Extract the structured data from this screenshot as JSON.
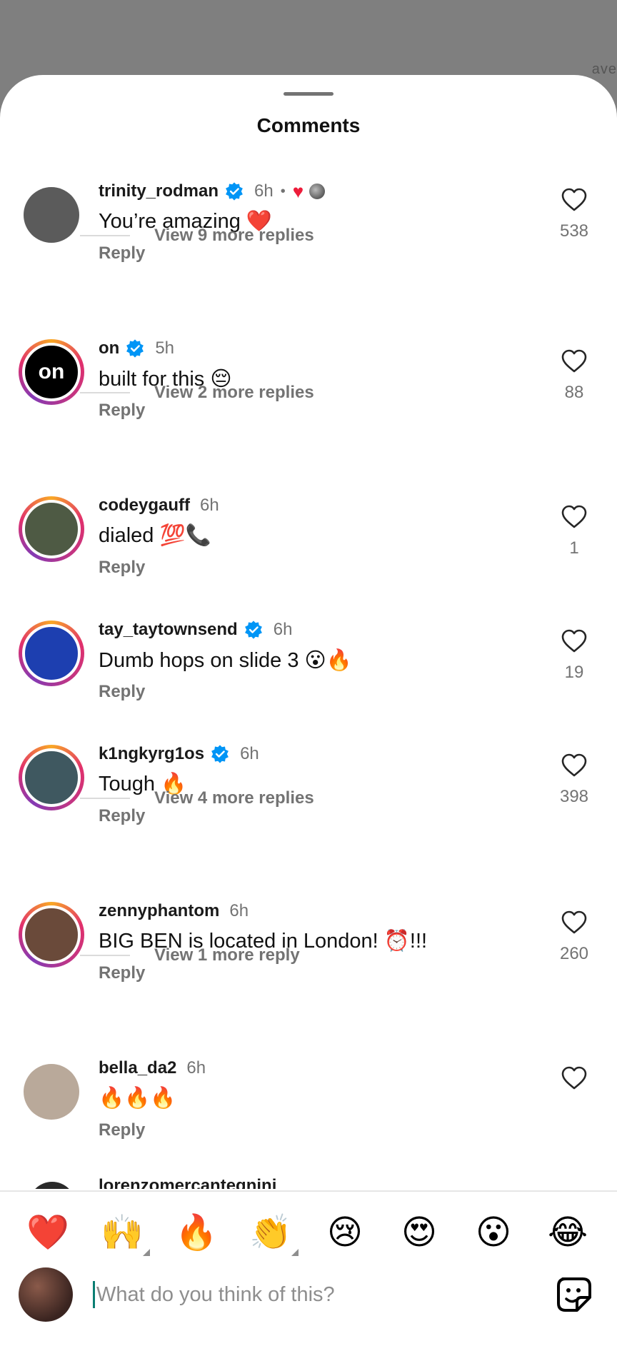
{
  "backdrop_peek": "ave",
  "sheet": {
    "title": "Comments"
  },
  "comments": [
    {
      "username": "trinity_rodman",
      "verified": true,
      "time": "6h",
      "liked_by_author": true,
      "text": "You’re amazing ❤️",
      "reply_label": "Reply",
      "likes": "538",
      "view_more": "View 9 more replies",
      "avatar_color": "#5b5b5b",
      "ring": false
    },
    {
      "username": "on",
      "verified": true,
      "time": "5h",
      "text": "built for this 😔",
      "reply_label": "Reply",
      "likes": "88",
      "view_more": "View 2 more replies",
      "avatar_color": "#000000",
      "avatar_text": "on",
      "ring": true
    },
    {
      "username": "codeygauff",
      "verified": false,
      "time": "6h",
      "text": "dialed 💯📞",
      "reply_label": "Reply",
      "likes": "1",
      "avatar_color": "#4e5a44",
      "ring": true
    },
    {
      "username": "tay_taytownsend",
      "verified": true,
      "time": "6h",
      "text": "Dumb hops on slide 3 😮🔥",
      "reply_label": "Reply",
      "likes": "19",
      "avatar_color": "#1d3fb0",
      "ring": true
    },
    {
      "username": "k1ngkyrg1os",
      "verified": true,
      "time": "6h",
      "text": "Tough 🔥",
      "reply_label": "Reply",
      "likes": "398",
      "view_more": "View 4 more replies",
      "avatar_color": "#3f5860",
      "ring": true
    },
    {
      "username": "zennyphantom",
      "verified": false,
      "time": "6h",
      "text": "BIG BEN is located in London! ⏰!!!",
      "reply_label": "Reply",
      "likes": "260",
      "view_more": "View 1 more reply",
      "avatar_color": "#6a4a3a",
      "ring": true
    },
    {
      "username": "bella_da2",
      "verified": false,
      "time": "6h",
      "text": "🔥🔥🔥",
      "reply_label": "Reply",
      "likes": "",
      "avatar_color": "#b9a99a",
      "ring": false
    }
  ],
  "partial_username": "lorenzomercantegnini",
  "quick_reactions": [
    "❤️",
    "🙌",
    "🔥",
    "👏",
    "😢",
    "😍",
    "😮",
    "😂"
  ],
  "composer": {
    "placeholder": "What do you think of this?"
  },
  "colors": {
    "accent_verified": "#0095f6",
    "muted": "#737373",
    "heart_red": "#ed1c3a"
  }
}
